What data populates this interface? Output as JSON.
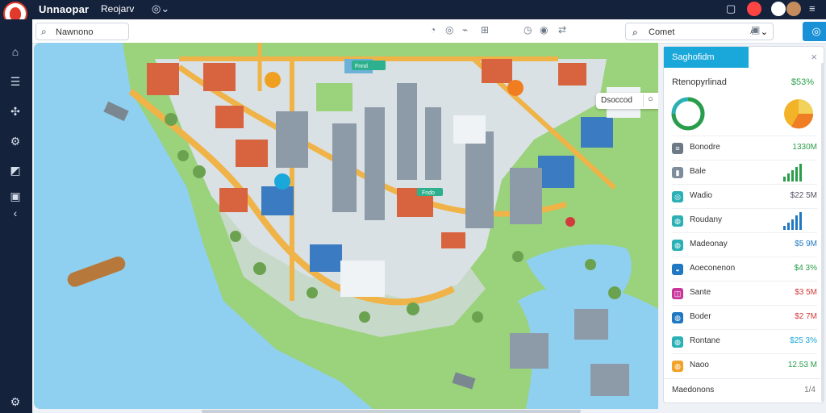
{
  "app": {
    "title": "Unnaopar",
    "menu": "Reojarv"
  },
  "icons": {
    "logo": "app-logo",
    "dropdown": "chevron-down-icon",
    "search": "search-icon",
    "settings": "gear-icon",
    "close": "close-icon"
  },
  "toolbar": {
    "search_placeholder": "Nawnono",
    "search2": "Comet"
  },
  "map": {
    "chip_text": "Dsoccod",
    "labels": [
      {
        "text": "Fnrol"
      },
      {
        "text": "Fndo"
      }
    ]
  },
  "panel": {
    "title": "Saghofidm",
    "close": "×",
    "summary_label": "Rtenopyrlinad",
    "summary_value": "$53%",
    "rows": [
      {
        "label": "Bonodre",
        "value": "1330M",
        "color": "#2a9d4a",
        "icon": "≡"
      },
      {
        "label": "Bale",
        "value": "",
        "color": "#2a9d4a",
        "icon": "▮"
      },
      {
        "label": "Wadio",
        "value": "$22 5M",
        "color": "#556",
        "icon": "◎"
      },
      {
        "label": "Roudany",
        "value": "",
        "color": "#1f78c1",
        "icon": "◍"
      },
      {
        "label": "Madeonay",
        "value": "$5 9M",
        "color": "#1f78c1",
        "icon": "◍"
      },
      {
        "label": "Aoeconenon",
        "value": "$4 3%",
        "color": "#2a9d4a",
        "icon": "◒"
      },
      {
        "label": "Sante",
        "value": "$3 5M",
        "color": "#d23b3b",
        "icon": "◫"
      },
      {
        "label": "Boder",
        "value": "$2 7M",
        "color": "#d23b3b",
        "icon": "◍"
      },
      {
        "label": "Rontane",
        "value": "$25 3%",
        "color": "#1aa7d9",
        "icon": "◍"
      },
      {
        "label": "Naoo",
        "value": "12.53 M",
        "color": "#2a9d4a",
        "icon": "◍"
      }
    ],
    "footer_label": "Maedonons",
    "footer_value": "1/4"
  }
}
